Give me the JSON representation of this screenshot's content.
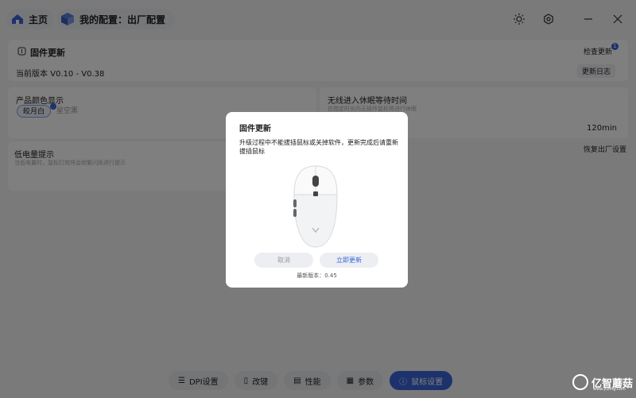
{
  "titlebar": {
    "home_label": "主页",
    "config_label": "我的配置：出厂配置",
    "icons": [
      "home-icon",
      "cube-icon",
      "brightness-icon",
      "settings-icon",
      "minimize-icon",
      "close-icon"
    ]
  },
  "firmware": {
    "title": "固件更新",
    "check_label": "检查更新",
    "badge": "1",
    "current_version": "当前版本 V0.10 - V0.38",
    "changelog_label": "更新日志"
  },
  "color": {
    "title": "产品颜色显示",
    "options": [
      "皎月白",
      "星空黑"
    ],
    "selected": "皎月白"
  },
  "sleep": {
    "title": "无线进入休眠等待时间",
    "desc": "在指定时长内无操作鼠标将进行休眠",
    "value": "120min"
  },
  "low_battery": {
    "title": "低电量提示",
    "desc": "当低电量时，鼠标灯效将会频繁闪烁进行提示"
  },
  "restore_label": "恢复出厂设置",
  "nav": [
    {
      "label": "DPI设置",
      "icon": "list-icon"
    },
    {
      "label": "改键",
      "icon": "mouse-icon"
    },
    {
      "label": "性能",
      "icon": "chart-icon"
    },
    {
      "label": "参数",
      "icon": "grid-icon"
    },
    {
      "label": "鼠标设置",
      "icon": "info-icon",
      "active": true
    }
  ],
  "watermark": {
    "name": "亿智蘑菇",
    "url": "www.yizmg.com"
  },
  "modal": {
    "title": "固件更新",
    "message": "升级过程中不能拔插鼠标或关掉软件，更新完成后请重新拔插鼠标",
    "cancel_label": "取消",
    "update_label": "立即更新",
    "latest_version": "最新版本：0.45"
  },
  "colors": {
    "accent": "#3a64d8",
    "overlay": "rgba(0,0,0,0.5)"
  }
}
